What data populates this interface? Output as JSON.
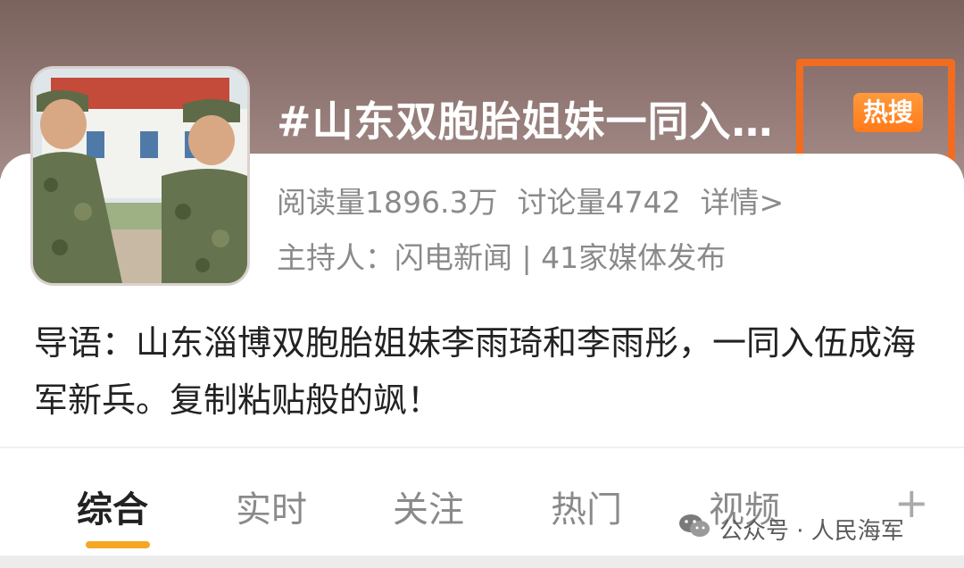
{
  "header": {
    "topic_title": "#山东双胞胎姐妹一同入…",
    "hot_badge": "热搜"
  },
  "meta": {
    "reads": "阅读量1896.3万",
    "discussions": "讨论量4742",
    "details_link": "详情>",
    "host_line": "主持人：闪电新闻 | 41家媒体发布"
  },
  "intro": {
    "text": "导语：山东淄博双胞胎姐妹李雨琦和李雨彤，一同入伍成海军新兵。复制粘贴般的飒！"
  },
  "tabs": [
    {
      "label": "综合",
      "active": true
    },
    {
      "label": "实时",
      "active": false
    },
    {
      "label": "关注",
      "active": false
    },
    {
      "label": "热门",
      "active": false
    },
    {
      "label": "视频",
      "active": false
    }
  ],
  "more_tab_icon": "plus-icon",
  "watermark": {
    "text": "公众号 · 人民海军",
    "icon": "wechat-icon"
  },
  "colors": {
    "accent": "#f26c20",
    "hot_badge": "#ff8a2a",
    "tab_underline": "#f5a623"
  }
}
